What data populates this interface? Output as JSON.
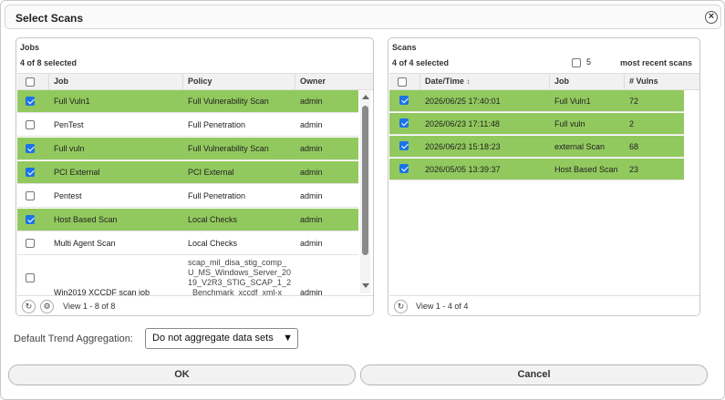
{
  "dialog": {
    "title": "Select Scans",
    "close_glyph": "×"
  },
  "jobs": {
    "title": "Jobs",
    "selected_text": "4 of 8 selected",
    "headers": [
      "Job",
      "Policy",
      "Owner"
    ],
    "rows": [
      {
        "job": "Full Vuln1",
        "policy": "Full Vulnerability Scan",
        "owner": "admin",
        "selected": true
      },
      {
        "job": "PenTest",
        "policy": "Full Penetration",
        "owner": "admin",
        "selected": false
      },
      {
        "job": "Full vuln",
        "policy": "Full Vulnerability Scan",
        "owner": "admin",
        "selected": true
      },
      {
        "job": "PCI External",
        "policy": "PCI External",
        "owner": "admin",
        "selected": true
      },
      {
        "job": "Pentest",
        "policy": "Full Penetration",
        "owner": "admin",
        "selected": false
      },
      {
        "job": "Host Based Scan",
        "policy": "Local Checks",
        "owner": "admin",
        "selected": true
      },
      {
        "job": "Multi Agent Scan",
        "policy": "Local Checks",
        "owner": "admin",
        "selected": false
      },
      {
        "job": "Win2019 XCCDF scan job",
        "policy": "scap_mil_disa_stig_comp_U_MS_Windows_Server_2019_V2R3_STIG_SCAP_1_2_Benchmark_xccdf_xml-x",
        "owner": "admin",
        "selected": false
      }
    ],
    "pager_text": "View 1 - 8 of 8",
    "refresh_icon": "↻",
    "settings_icon": "⚙"
  },
  "scans": {
    "title": "Scans",
    "selected_text": "4 of 4 selected",
    "recent_count": "5",
    "recent_label": "most recent scans",
    "headers": [
      "Date/Time",
      "Job",
      "# Vulns"
    ],
    "sort_icon": "↕",
    "rows": [
      {
        "datetime": "2026/06/25 17:40:01",
        "job": "Full Vuln1",
        "vulns": "72",
        "selected": true
      },
      {
        "datetime": "2026/06/23 17:11:48",
        "job": "Full vuln",
        "vulns": "2",
        "selected": true
      },
      {
        "datetime": "2026/06/23 15:18:23",
        "job": "external Scan",
        "vulns": "68",
        "selected": true
      },
      {
        "datetime": "2026/05/05 13:39:37",
        "job": "Host Based Scan",
        "vulns": "23",
        "selected": true
      }
    ],
    "pager_text": "View 1 - 4 of 4",
    "refresh_icon": "↻"
  },
  "trend": {
    "label": "Default Trend Aggregation:",
    "selected": "Do not aggregate data sets",
    "chevron": "⌄"
  },
  "buttons": {
    "ok": "OK",
    "cancel": "Cancel"
  },
  "colors": {
    "selected_row": "#92c95e",
    "checkbox_checked": "#1a73e8"
  }
}
